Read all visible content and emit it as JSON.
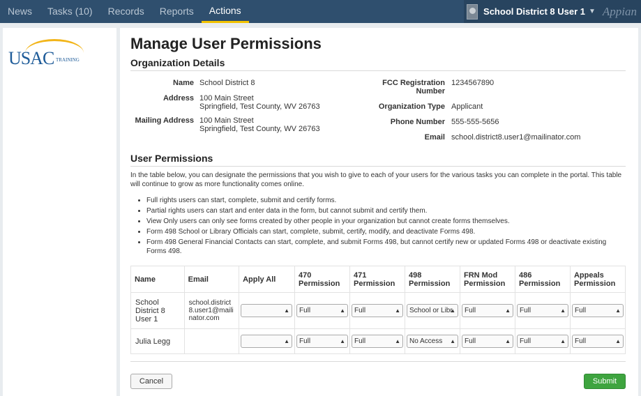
{
  "nav": {
    "items": [
      "News",
      "Tasks (10)",
      "Records",
      "Reports",
      "Actions"
    ],
    "active": "Actions",
    "user": "School District 8 User 1",
    "brand": "Appian"
  },
  "logo": {
    "text": "USAC",
    "sub": "TRAINING"
  },
  "page": {
    "title": "Manage User Permissions"
  },
  "org": {
    "section_title": "Organization Details",
    "name_label": "Name",
    "name": "School District 8",
    "address_label": "Address",
    "address_line1": "100 Main Street",
    "address_line2": "Springfield, Test County, WV 26763",
    "mailing_label": "Mailing Address",
    "mailing_line1": "100 Main Street",
    "mailing_line2": "Springfield, Test County, WV 26763",
    "fcc_label_1": "FCC Registration",
    "fcc_label_2": "Number",
    "fcc": "1234567890",
    "type_label": "Organization Type",
    "type": "Applicant",
    "phone_label": "Phone Number",
    "phone": "555-555-5656",
    "email_label": "Email",
    "email": "school.district8.user1@mailinator.com"
  },
  "perms": {
    "section_title": "User Permissions",
    "intro": "In the table below, you can designate the permissions that you wish to give to each of your users for the various tasks you can complete in the portal. This table will continue to grow as more functionality comes online.",
    "bullets": [
      "Full rights users can start, complete, submit and certify forms.",
      "Partial rights users can start and enter data in the form, but cannot submit and certify them.",
      "View Only users can only see forms created by other people in your organization but cannot create forms themselves.",
      "Form 498 School or Library Officials can start, complete, submit, certify, modify, and deactivate Forms 498.",
      "Form 498 General Financial Contacts can start, complete, and submit Forms 498, but cannot certify new or updated Forms 498 or deactivate existing Forms 498."
    ],
    "headers": [
      "Name",
      "Email",
      "Apply All",
      "470 Permission",
      "471 Permission",
      "498 Permission",
      "FRN Mod Permission",
      "486 Permission",
      "Appeals Permission"
    ],
    "rows": [
      {
        "name": "School District 8 User 1",
        "email": "school.district 8.user1@maili nator.com",
        "apply_all": "",
        "p470": "Full",
        "p471": "Full",
        "p498": "School or Libr",
        "frn": "Full",
        "p486": "Full",
        "appeals": "Full"
      },
      {
        "name": "Julia Legg",
        "email": "",
        "apply_all": "",
        "p470": "Full",
        "p471": "Full",
        "p498": "No Access",
        "frn": "Full",
        "p486": "Full",
        "appeals": "Full"
      }
    ]
  },
  "buttons": {
    "cancel": "Cancel",
    "submit": "Submit"
  },
  "colors": {
    "topbar": "#2f4f6e",
    "accent": "#f2c200",
    "link": "#2a6da8",
    "submit": "#3ea43f"
  }
}
